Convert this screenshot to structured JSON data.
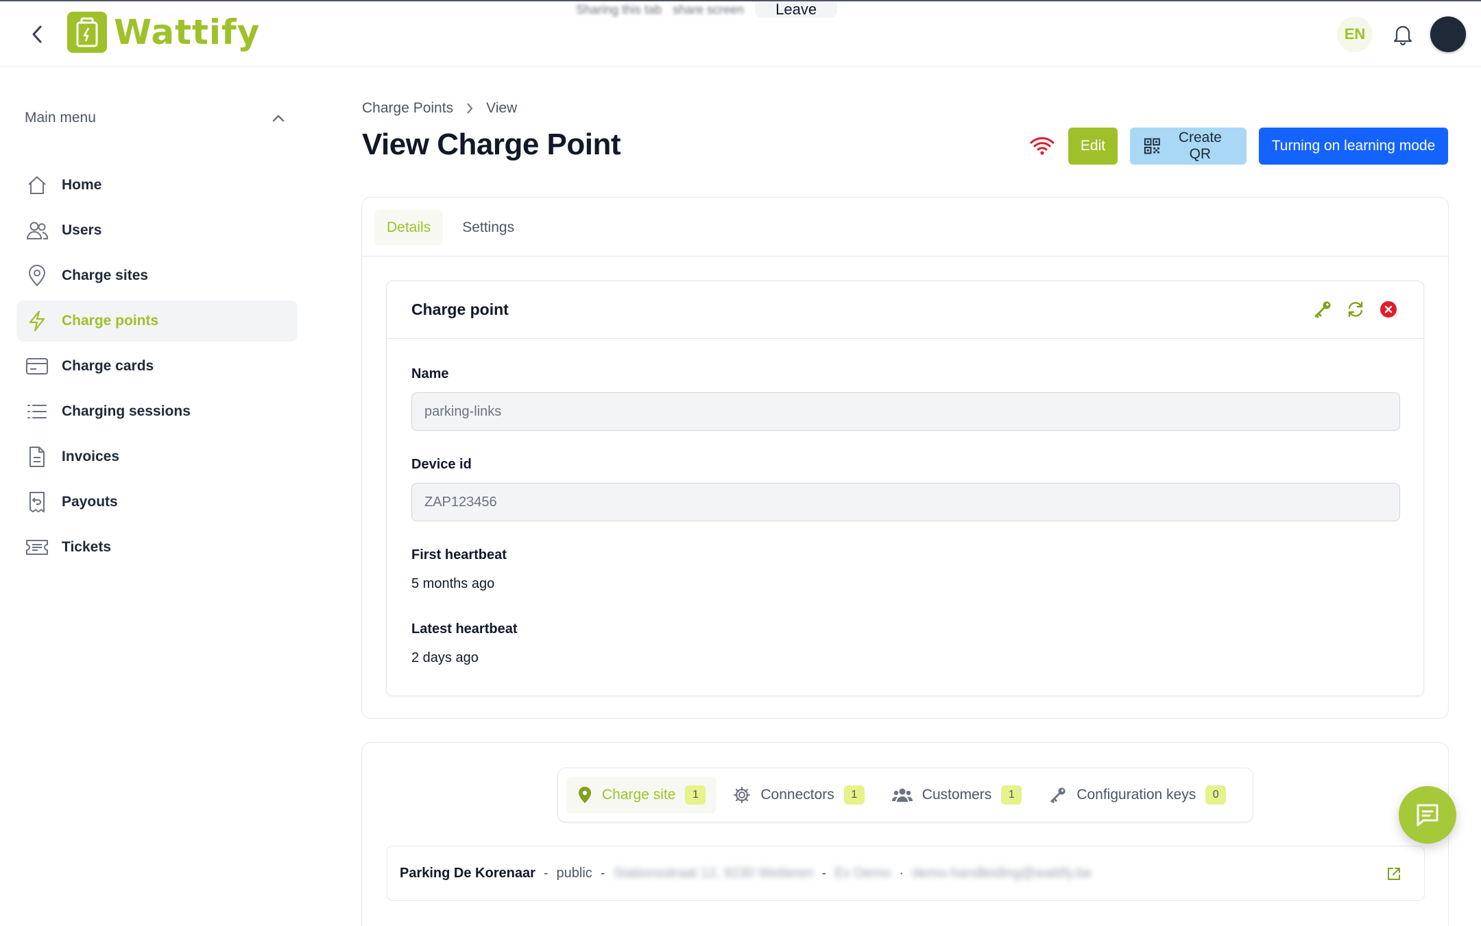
{
  "app": {
    "name": "Wattify"
  },
  "screenshare": {
    "text": "Sharing this tab",
    "blurred": "share screen",
    "leave_label": "Leave"
  },
  "header": {
    "language": "EN"
  },
  "sidebar": {
    "title": "Main menu",
    "items": [
      {
        "label": "Home",
        "icon": "home-icon",
        "active": false
      },
      {
        "label": "Users",
        "icon": "users-icon",
        "active": false
      },
      {
        "label": "Charge sites",
        "icon": "map-pin-icon",
        "active": false
      },
      {
        "label": "Charge points",
        "icon": "lightning-icon",
        "active": true
      },
      {
        "label": "Charge cards",
        "icon": "card-icon",
        "active": false
      },
      {
        "label": "Charging sessions",
        "icon": "list-icon",
        "active": false
      },
      {
        "label": "Invoices",
        "icon": "document-icon",
        "active": false
      },
      {
        "label": "Payouts",
        "icon": "receipt-icon",
        "active": false
      },
      {
        "label": "Tickets",
        "icon": "ticket-icon",
        "active": false
      }
    ]
  },
  "breadcrumb": {
    "parent": "Charge Points",
    "current": "View"
  },
  "page": {
    "title": "View Charge Point"
  },
  "actions": {
    "edit": "Edit",
    "create_qr": "Create QR",
    "learning_mode": "Turning on learning mode"
  },
  "tabs": {
    "details": "Details",
    "settings": "Settings",
    "active": "Details"
  },
  "charge_point": {
    "title": "Charge point",
    "name_label": "Name",
    "name_value": "parking-links",
    "device_label": "Device id",
    "device_value": "ZAP123456",
    "first_heartbeat_label": "First heartbeat",
    "first_heartbeat_value": "5 months ago",
    "latest_heartbeat_label": "Latest heartbeat",
    "latest_heartbeat_value": "2 days ago"
  },
  "related_tabs": [
    {
      "label": "Charge site",
      "count": "1",
      "icon": "map-pin-icon",
      "active": true
    },
    {
      "label": "Connectors",
      "count": "1",
      "icon": "gear-icon",
      "active": false
    },
    {
      "label": "Customers",
      "count": "1",
      "icon": "users-group-icon",
      "active": false
    },
    {
      "label": "Configuration keys",
      "count": "0",
      "icon": "key-icon",
      "active": false
    }
  ],
  "charge_site_row": {
    "name": "Parking De Korenaar",
    "visibility": "public",
    "address_blurred": "Stationsstraat 12, 9230 Wetteren",
    "owner_blurred": "Ev Demo",
    "email_blurred": "demo-handleiding@wattify.be"
  },
  "colors": {
    "brand": "#9ec12a",
    "primary": "#1563ff",
    "qr": "#a8d8f5",
    "danger": "#e11d2b"
  }
}
